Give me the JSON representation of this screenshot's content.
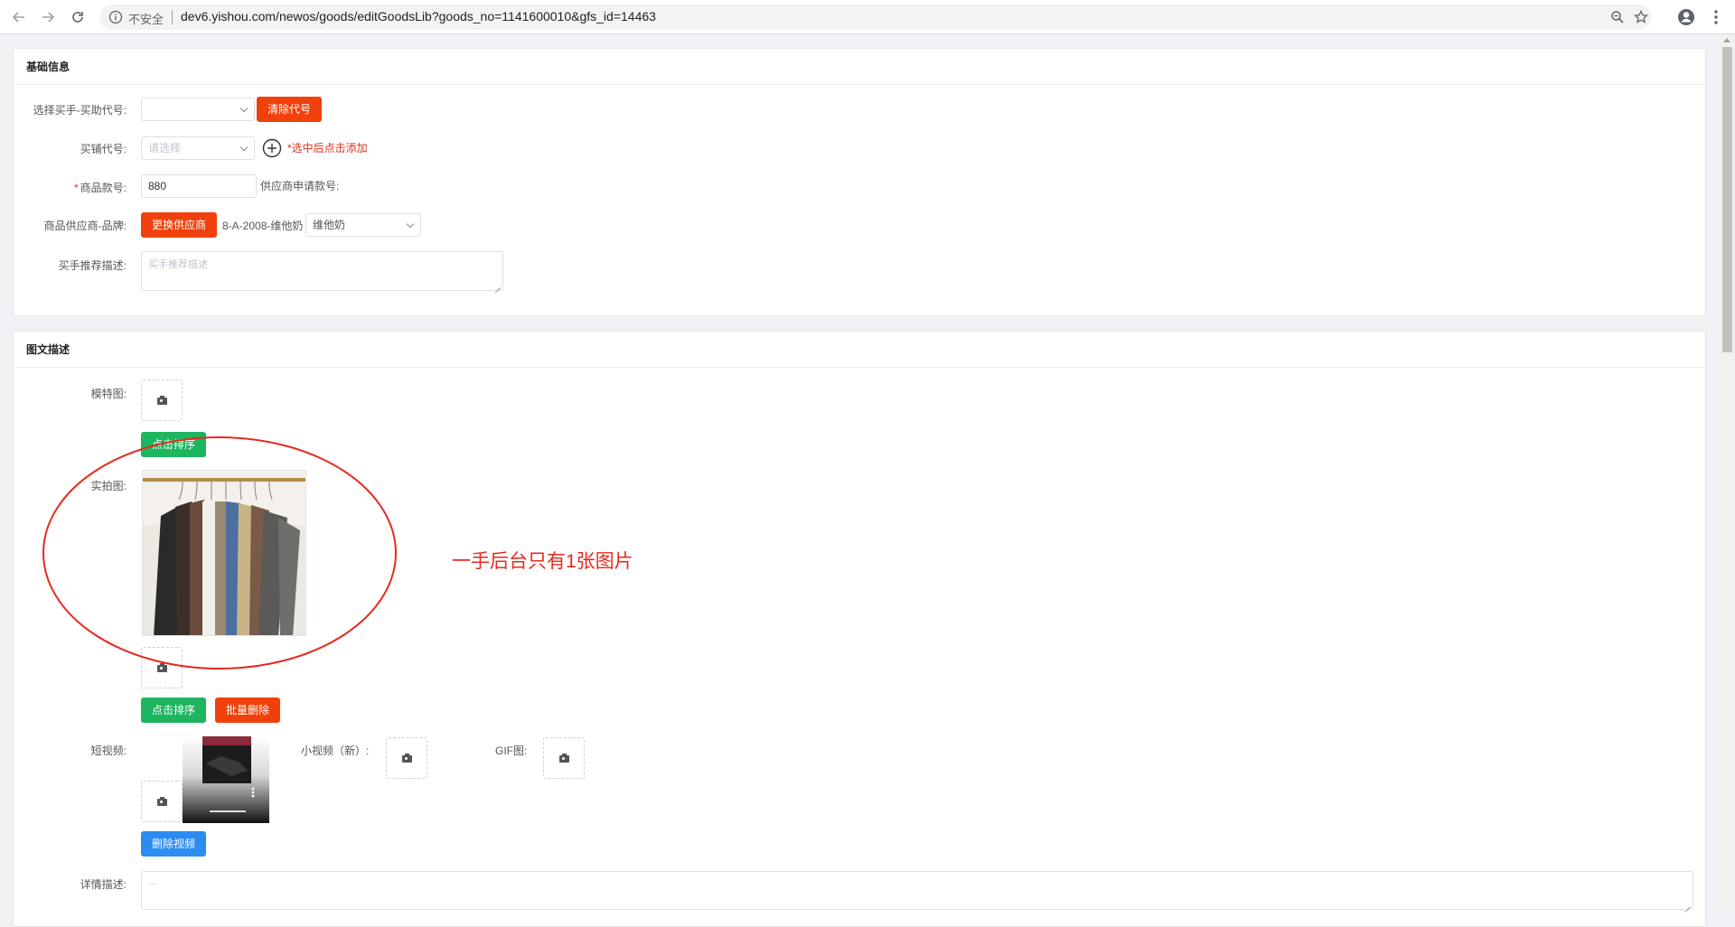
{
  "browser": {
    "insecure_label": "不安全",
    "url": "dev6.yishou.com/newos/goods/editGoodsLib?goods_no=1141600010&gfs_id=14463"
  },
  "basic_info": {
    "title": "基础信息",
    "buyer_code_label": "选择买手-买助代号:",
    "buyer_code_value": "",
    "clear_code_button": "清除代号",
    "shop_code_label": "买铺代号:",
    "shop_code_placeholder": "请选择",
    "shop_code_hint": "*选中后点击添加",
    "item_no_label": "商品款号:",
    "item_no_value": "880",
    "supplier_no_label": "供应商申请款号:",
    "supplier_label": "商品供应商-品牌:",
    "change_supplier_button": "更换供应商",
    "supplier_value": "8-A-2008-维他奶",
    "brand_value": "维他奶",
    "desc_label": "买手推荐描述:",
    "desc_placeholder": "买手推荐描述"
  },
  "media": {
    "title": "图文描述",
    "model_img_label": "模特图:",
    "sort_button_1": "点击排序",
    "real_img_label": "实拍图:",
    "sort_button_2": "点击排序",
    "batch_delete_button": "批量删除",
    "short_video_label": "短视频:",
    "small_video_label": "小视频（新）:",
    "gif_label": "GIF图:",
    "delete_video_button": "删除视频",
    "detail_desc_label": "详情描述:",
    "detail_desc_placeholder": "..."
  },
  "annotation": {
    "text": "一手后台只有1张图片",
    "color": "#e62a1f"
  }
}
